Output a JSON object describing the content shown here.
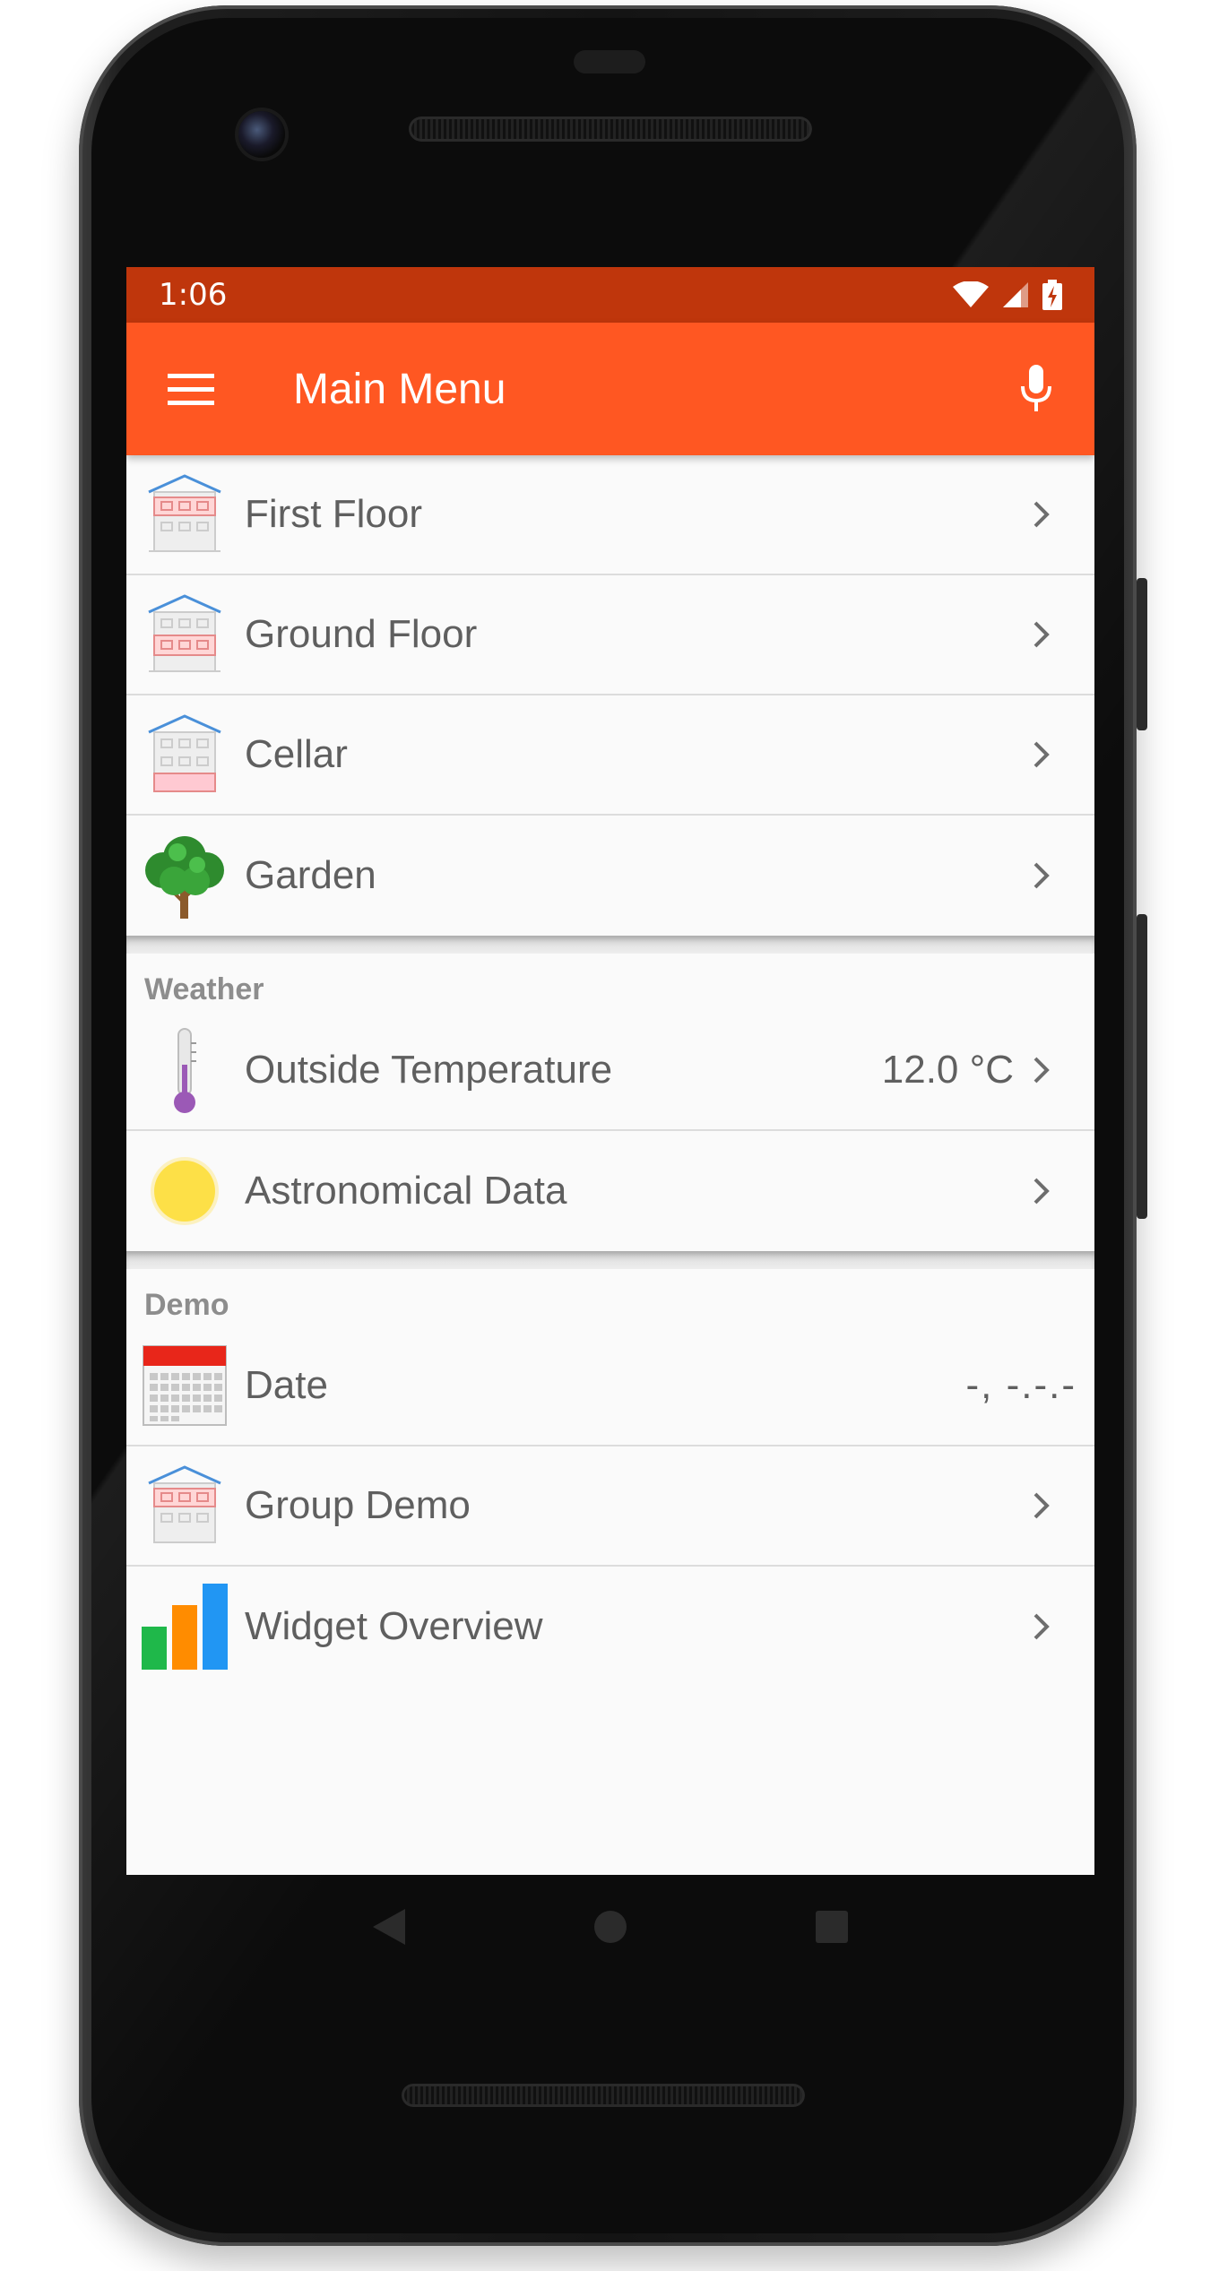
{
  "status_bar": {
    "time": "1:06"
  },
  "app_bar": {
    "title": "Main Menu"
  },
  "main_items": [
    {
      "label": "First Floor",
      "icon": "house-first-floor-icon"
    },
    {
      "label": "Ground Floor",
      "icon": "house-ground-floor-icon"
    },
    {
      "label": "Cellar",
      "icon": "house-cellar-icon"
    },
    {
      "label": "Garden",
      "icon": "tree-icon"
    }
  ],
  "weather": {
    "header": "Weather",
    "items": [
      {
        "label": "Outside Temperature",
        "value": "12.0 °C",
        "icon": "thermometer-icon"
      },
      {
        "label": "Astronomical Data",
        "icon": "sun-icon"
      }
    ]
  },
  "demo": {
    "header": "Demo",
    "items": [
      {
        "label": "Date",
        "value": "-, -.-.-",
        "icon": "calendar-icon"
      },
      {
        "label": "Group Demo",
        "icon": "house-group-icon"
      },
      {
        "label": "Widget Overview",
        "icon": "bar-chart-icon"
      }
    ]
  },
  "colors": {
    "status_bar": "#bf360c",
    "app_bar": "#ff5722",
    "background": "#fafafa",
    "text": "#5f5f5f",
    "section_header": "#8d8d8d"
  }
}
